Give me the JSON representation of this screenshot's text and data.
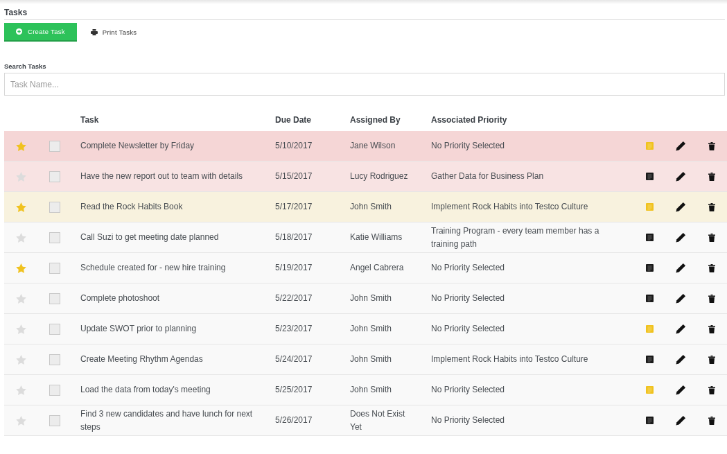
{
  "page_title": "Tasks",
  "toolbar": {
    "create_button": "Create Task",
    "print_button": "Print Tasks"
  },
  "search": {
    "label": "Search Tasks",
    "placeholder": "Task Name..."
  },
  "table": {
    "columns": [
      "Task",
      "Due Date",
      "Assigned By",
      "Associated Priority"
    ],
    "rows": [
      {
        "starred": true,
        "checked": false,
        "task": "Complete Newsletter by Friday",
        "due": "5/10/2017",
        "assigned_by": "Jane Wilson",
        "priority": "No Priority Selected",
        "has_note": true,
        "color": "#f5d6d6"
      },
      {
        "starred": false,
        "checked": false,
        "task": "Have the new report out to team with details",
        "due": "5/15/2017",
        "assigned_by": "Lucy Rodriguez",
        "priority": "Gather Data for Business Plan",
        "has_note": false,
        "color": "#f8e3e3"
      },
      {
        "starred": true,
        "checked": false,
        "task": "Read the Rock Habits Book",
        "due": "5/17/2017",
        "assigned_by": "John Smith",
        "priority": "Implement Rock Habits into Testco Culture",
        "has_note": true,
        "color": "#f8f2de"
      },
      {
        "starred": false,
        "checked": false,
        "task": "Call Suzi to get meeting date planned",
        "due": "5/18/2017",
        "assigned_by": "Katie Williams",
        "priority": "Training Program - every team member has a training path",
        "has_note": false,
        "color": "#f9f9f9"
      },
      {
        "starred": true,
        "checked": false,
        "task": "Schedule created for - new hire training",
        "due": "5/19/2017",
        "assigned_by": "Angel Cabrera",
        "priority": "No Priority Selected",
        "has_note": false,
        "color": "#f9f9f9"
      },
      {
        "starred": false,
        "checked": false,
        "task": "Complete photoshoot",
        "due": "5/22/2017",
        "assigned_by": "John Smith",
        "priority": "No Priority Selected",
        "has_note": false,
        "color": "#f9f9f9"
      },
      {
        "starred": false,
        "checked": false,
        "task": "Update SWOT prior to planning",
        "due": "5/23/2017",
        "assigned_by": "John Smith",
        "priority": "No Priority Selected",
        "has_note": true,
        "color": "#f9f9f9"
      },
      {
        "starred": false,
        "checked": false,
        "task": "Create Meeting Rhythm Agendas",
        "due": "5/24/2017",
        "assigned_by": "John Smith",
        "priority": "Implement Rock Habits into Testco Culture",
        "has_note": false,
        "color": "#f9f9f9"
      },
      {
        "starred": false,
        "checked": false,
        "task": "Load the data from today's meeting",
        "due": "5/25/2017",
        "assigned_by": "John Smith",
        "priority": "No Priority Selected",
        "has_note": true,
        "color": "#f9f9f9"
      },
      {
        "starred": false,
        "checked": false,
        "task": "Find 3 new candidates and have lunch for next steps",
        "due": "5/26/2017",
        "assigned_by": "Does Not Exist Yet",
        "priority": "No Priority Selected",
        "has_note": false,
        "color": "#f9f9f9"
      }
    ]
  }
}
